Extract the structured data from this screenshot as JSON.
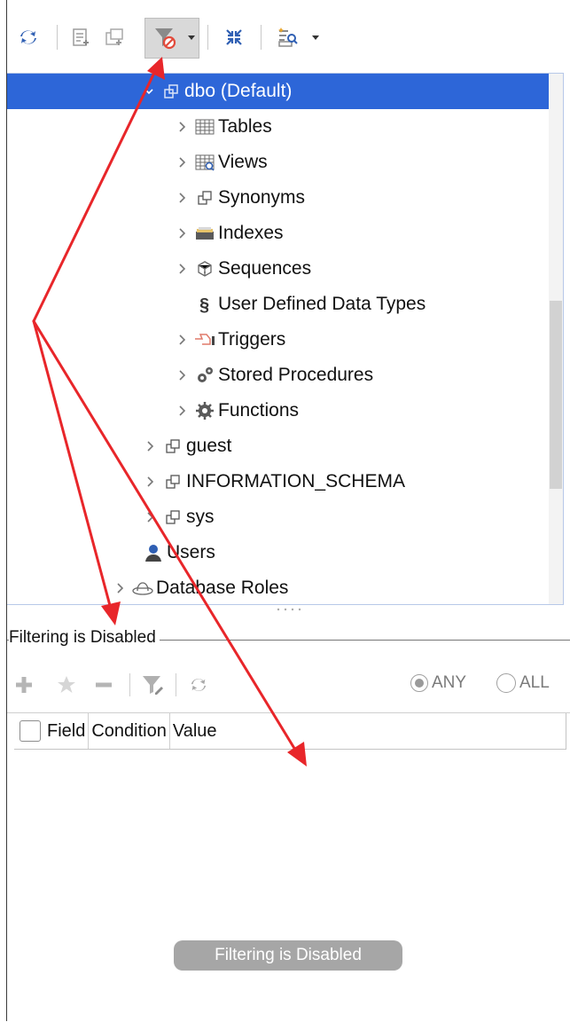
{
  "tree": {
    "selected_schema": "dbo  (Default)",
    "items": [
      {
        "label": "Tables",
        "icon": "table-icon"
      },
      {
        "label": "Views",
        "icon": "view-icon"
      },
      {
        "label": "Synonyms",
        "icon": "synonym-icon"
      },
      {
        "label": "Indexes",
        "icon": "index-icon"
      },
      {
        "label": "Sequences",
        "icon": "sequence-icon"
      },
      {
        "label": "User Defined Data Types",
        "icon": "udt-icon"
      },
      {
        "label": "Triggers",
        "icon": "trigger-icon"
      },
      {
        "label": "Stored Procedures",
        "icon": "stored-procedure-icon"
      },
      {
        "label": "Functions",
        "icon": "function-icon"
      }
    ],
    "schemas": [
      {
        "label": "guest"
      },
      {
        "label": "INFORMATION_SCHEMA"
      },
      {
        "label": "sys"
      }
    ],
    "users": "Users",
    "database_roles": "Database Roles"
  },
  "filter": {
    "legend": "Filtering is Disabled",
    "any_label": "ANY",
    "all_label": "ALL",
    "selected_mode": "ANY",
    "columns": [
      "Field",
      "Condition",
      "Value"
    ],
    "empty_message": "Filtering is Disabled"
  },
  "colors": {
    "selection": "#2d66d8",
    "arrow": "#e8262a",
    "empty_badge": "#a6a6a6"
  }
}
